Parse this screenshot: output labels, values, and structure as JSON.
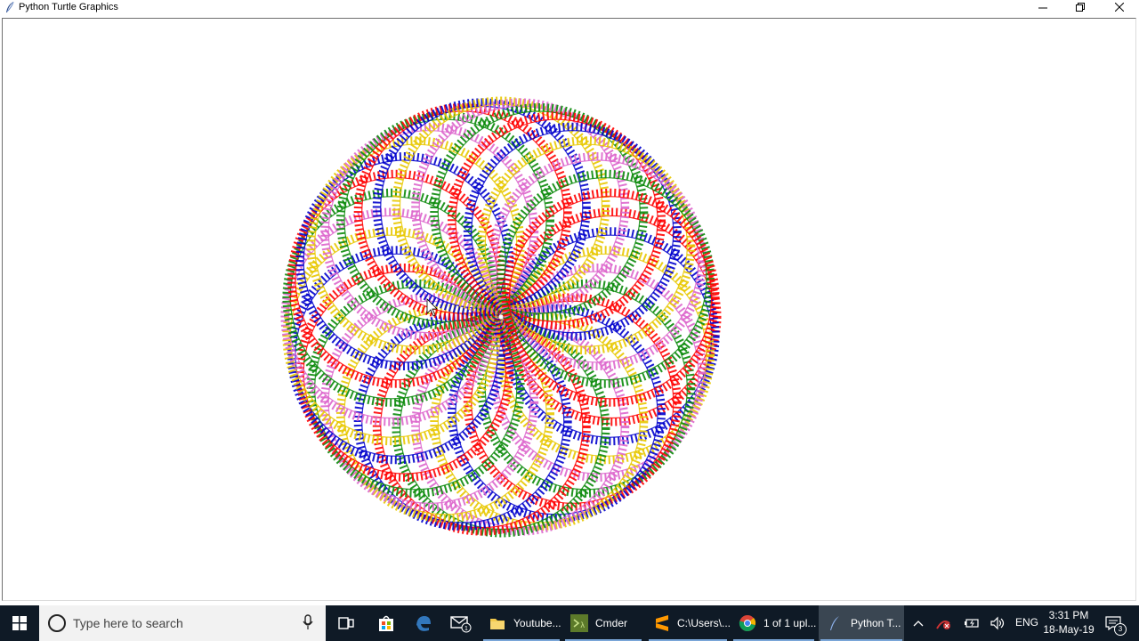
{
  "window": {
    "title": "Python Turtle Graphics",
    "controls": [
      "minimize",
      "maximize",
      "close"
    ]
  },
  "turtle_drawing": {
    "pen_colors": [
      "#ff0000",
      "#0000cc",
      "#e8c800",
      "#dd66cc",
      "#0a8a0a"
    ],
    "ring_count": 36,
    "cursor_icon": "mouse-arrow-icon"
  },
  "taskbar": {
    "search_placeholder": "Type here to search",
    "apps": [
      {
        "label": "Youtube...",
        "icon": "folder-icon"
      },
      {
        "label": "Cmder",
        "icon": "cmder-icon"
      },
      {
        "label": "C:\\Users\\...",
        "icon": "sublime-icon"
      },
      {
        "label": "1 of 1 upl...",
        "icon": "chrome-icon"
      },
      {
        "label": "Python T...",
        "icon": "python-turtle-icon",
        "active": true
      }
    ],
    "tray": {
      "language": "ENG",
      "time": "3:31 PM",
      "date": "18-May-19",
      "notifications": "3"
    },
    "accent": "#7aa6d8",
    "background": "#0f1a26"
  }
}
